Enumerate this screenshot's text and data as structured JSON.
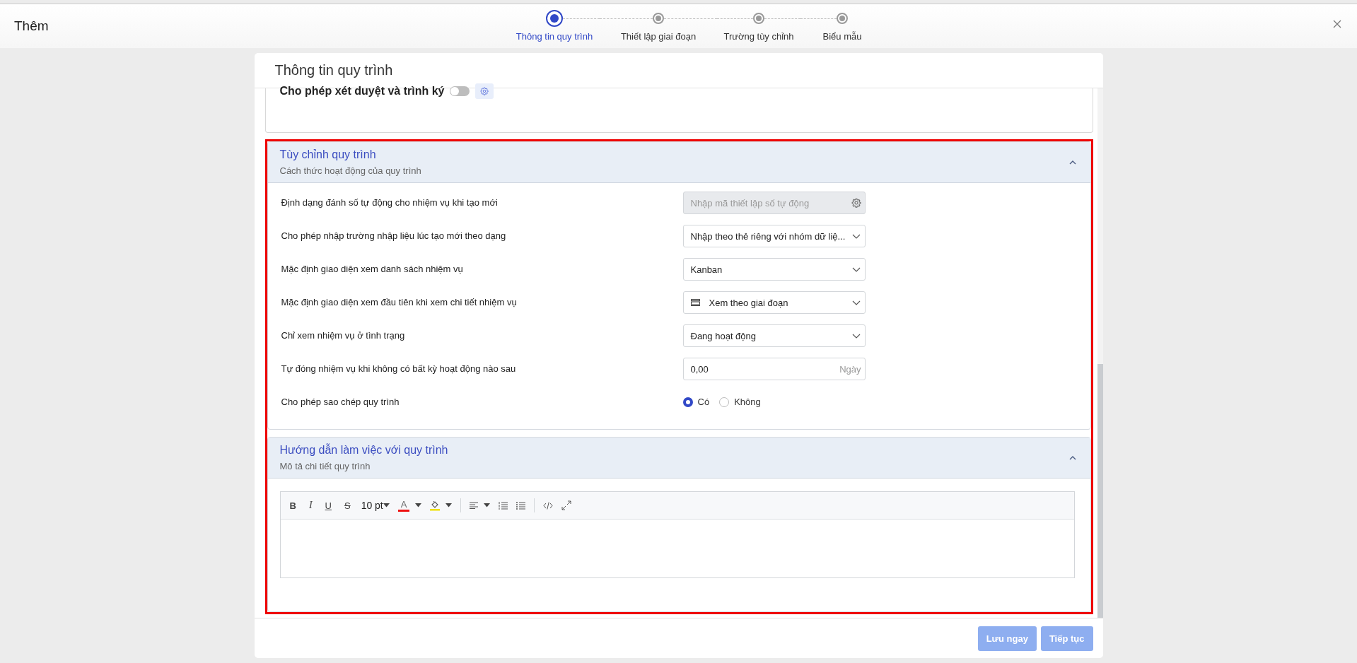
{
  "window": {
    "title": "Thêm"
  },
  "steps": [
    {
      "label": "Thông tin quy trình",
      "selected": true
    },
    {
      "label": "Thiết lập giai đoạn",
      "selected": false
    },
    {
      "label": "Trường tùy chỉnh",
      "selected": false
    },
    {
      "label": "Biểu mẫu",
      "selected": false
    }
  ],
  "card": {
    "title": "Thông tin quy trình"
  },
  "approval": {
    "label": "Cho phép xét duyệt và trình ký",
    "on": false
  },
  "highlight_frame": true,
  "customization": {
    "title": "Tùy chỉnh quy trình",
    "subtitle": "Cách thức hoạt động của quy trình",
    "expanded": true,
    "fields": [
      {
        "kind": "code",
        "label": "Định dạng đánh số tự động cho nhiệm vụ khi tạo mới",
        "placeholder": "Nhập mã thiết lập số tự động",
        "disabled": true
      },
      {
        "kind": "select",
        "label": "Cho phép nhập trường nhập liệu lúc tạo mới theo dạng",
        "value": "Nhập theo thẻ riêng với nhóm dữ liệ..."
      },
      {
        "kind": "select",
        "label": "Mặc định giao diện xem danh sách nhiệm vụ",
        "value": "Kanban"
      },
      {
        "kind": "view_select",
        "label": "Mặc định giao diện xem đầu tiên khi xem chi tiết nhiệm vụ",
        "value": "Xem theo giai đoạn"
      },
      {
        "kind": "select",
        "label": "Chỉ xem nhiệm vụ ở tình trạng",
        "value": "Đang hoạt động"
      },
      {
        "kind": "number",
        "label": "Tự đóng nhiệm vụ khi không có bất kỳ hoạt động nào sau",
        "value": "0,00",
        "unit": "Ngày"
      },
      {
        "kind": "radio",
        "label": "Cho phép sao chép quy trình",
        "options": [
          {
            "label": "Có",
            "selected": true
          },
          {
            "label": "Không",
            "selected": false
          }
        ]
      }
    ]
  },
  "guide": {
    "title": "Hướng dẫn làm việc với quy trình",
    "subtitle": "Mô tả chi tiết quy trình",
    "expanded": true,
    "toolbar": {
      "bold": "B",
      "italic": "I",
      "underline": "U",
      "strike": "S",
      "font_size": "10 pt",
      "text_color": "A"
    }
  },
  "buttons": [
    {
      "label": "Lưu ngay",
      "disabled": true
    },
    {
      "label": "Tiếp tục",
      "disabled": true
    }
  ]
}
